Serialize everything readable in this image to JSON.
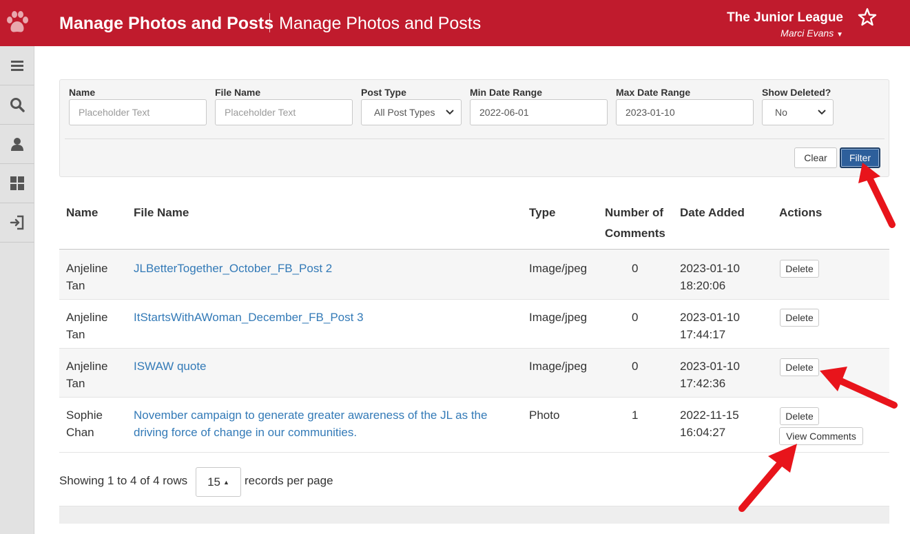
{
  "header": {
    "title": "Manage Photos and Posts",
    "subtitle": "Manage Photos and Posts",
    "org_name": "The Junior League",
    "user_name": "Marci Evans",
    "brand_color": "#c01b2d"
  },
  "sidebar": {
    "items": [
      "menu-icon",
      "search-icon",
      "user-icon",
      "dashboard-icon",
      "logout-icon"
    ]
  },
  "filters": {
    "name": {
      "label": "Name",
      "placeholder": "Placeholder Text"
    },
    "file_name": {
      "label": "File Name",
      "placeholder": "Placeholder Text"
    },
    "post_type": {
      "label": "Post Type",
      "value": "All Post Types"
    },
    "min_date": {
      "label": "Min Date Range",
      "value": "2022-06-01"
    },
    "max_date": {
      "label": "Max Date Range",
      "value": "2023-01-10"
    },
    "show_deleted": {
      "label": "Show Deleted?",
      "value": "No"
    },
    "clear_label": "Clear",
    "filter_label": "Filter"
  },
  "table": {
    "headers": {
      "name": "Name",
      "file_name": "File Name",
      "type": "Type",
      "comments_line1": "Number of",
      "comments_line2": "Comments",
      "date_added": "Date Added",
      "actions": "Actions"
    },
    "rows": [
      {
        "name_first": "Anjeline",
        "name_last": "Tan",
        "file_line1": "JLBetterTogether_October_FB_Post 2",
        "file_line2": "",
        "type": "Image/jpeg",
        "comments": "0",
        "date": "2023-01-10",
        "time": "18:20:06",
        "delete_label": "Delete"
      },
      {
        "name_first": "Anjeline",
        "name_last": "Tan",
        "file_line1": "ItStartsWithAWoman_December_FB_Post 3",
        "file_line2": "",
        "type": "Image/jpeg",
        "comments": "0",
        "date": "2023-01-10",
        "time": "17:44:17",
        "delete_label": "Delete"
      },
      {
        "name_first": "Anjeline",
        "name_last": "Tan",
        "file_line1": "ISWAW quote",
        "file_line2": "",
        "type": "Image/jpeg",
        "comments": "0",
        "date": "2023-01-10",
        "time": "17:42:36",
        "delete_label": "Delete"
      },
      {
        "name_first": "Sophie",
        "name_last": "Chan",
        "file_line1": "November campaign to generate greater awareness of the JL as the",
        "file_line2": "driving force of change in our communities.",
        "type": "Photo",
        "comments": "1",
        "date": "2022-11-15",
        "time": "16:04:27",
        "delete_label": "Delete",
        "view_label": "View Comments"
      }
    ]
  },
  "pagination": {
    "showing": "Showing 1 to 4 of 4 rows",
    "page_size": "15",
    "suffix": "records per page"
  },
  "annotations": {
    "arrow_color": "#e8141b"
  }
}
